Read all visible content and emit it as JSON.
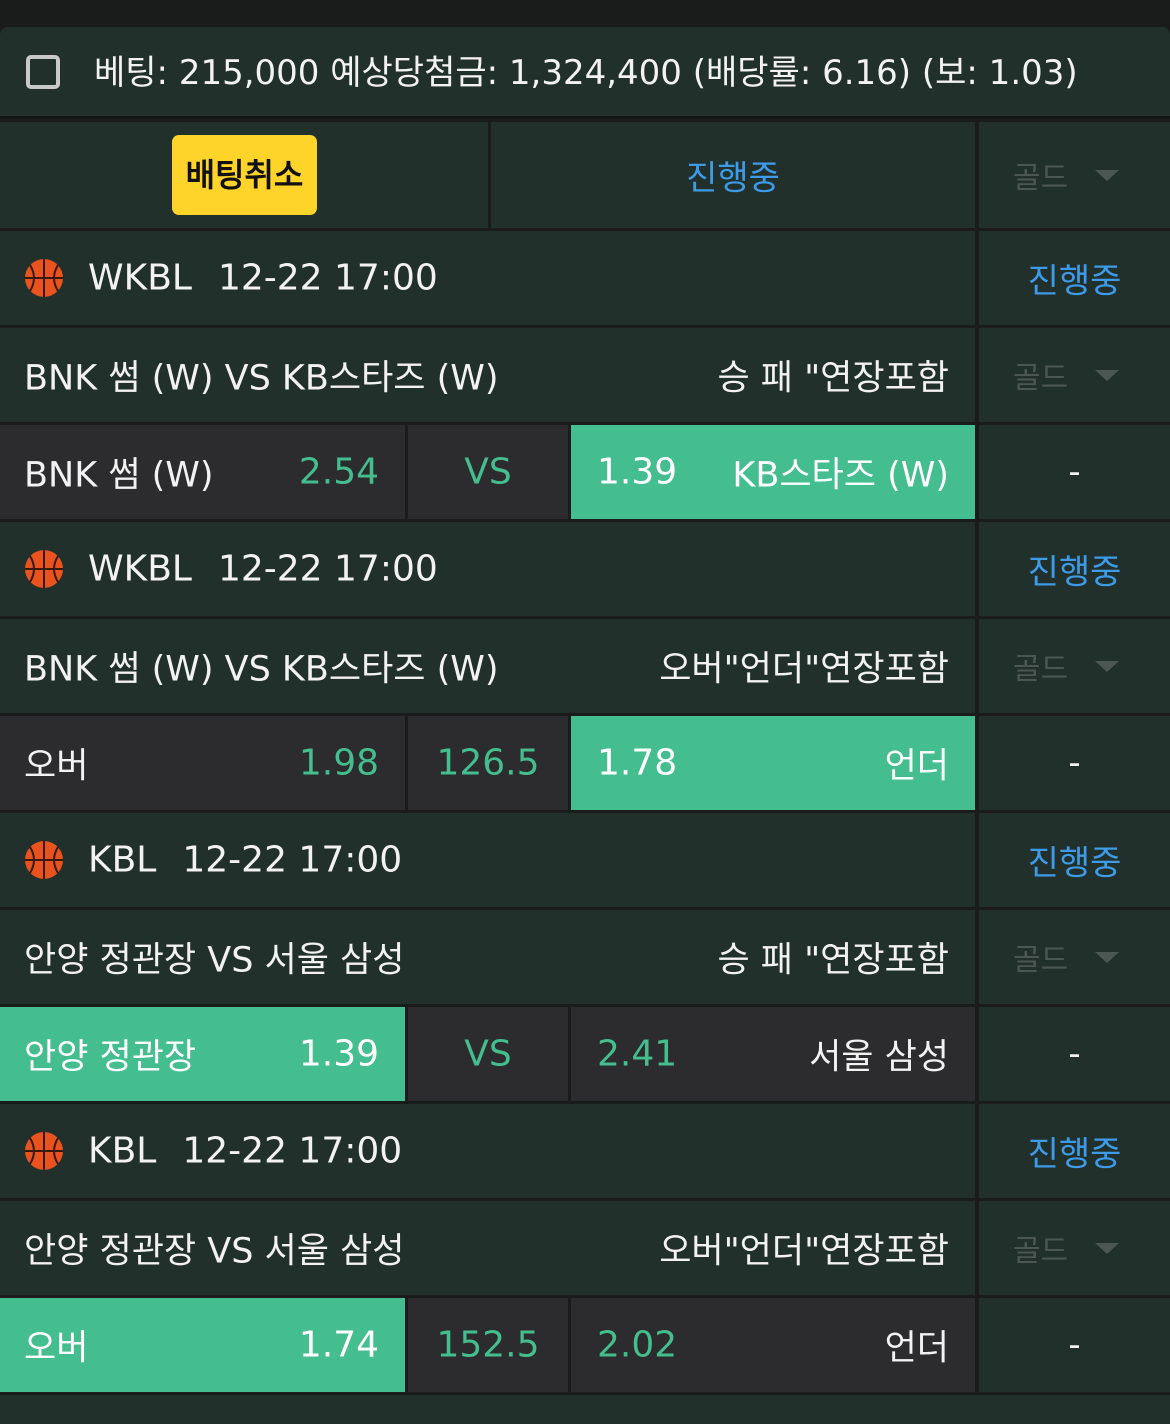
{
  "summary": {
    "text": "베팅: 215,000 예상당첨금: 1,324,400 (배당률: 6.16) (보: 1.03)"
  },
  "controls": {
    "cancel_label": "배팅취소",
    "status_label": "진행중",
    "gold_label": "골드"
  },
  "icons": {
    "league": "basketball-icon",
    "dropdown": "caret-down-icon",
    "checkbox": "checkbox-icon"
  },
  "colors": {
    "panel": "#21302b",
    "odds_bg": "#2c2c2e",
    "selected": "#44bd8f",
    "status": "#3d9be9",
    "cancel_button": "#ffd42a"
  },
  "bets": [
    {
      "league": "WKBL",
      "datetime": "12-22 17:00",
      "status": "진행중",
      "match": "BNK 썸 (W)  VS KB스타즈 (W)",
      "market": "승 패 \"연장포함",
      "gold": "골드",
      "home_name": "BNK 썸 (W)",
      "home_odds": "2.54",
      "middle": "VS",
      "away_odds": "1.39",
      "away_name": "KB스타즈 (W)",
      "selected": "away",
      "result": "-"
    },
    {
      "league": "WKBL",
      "datetime": "12-22 17:00",
      "status": "진행중",
      "match": "BNK 썸 (W)  VS KB스타즈 (W)",
      "market": "오버\"언더\"연장포함",
      "gold": "골드",
      "home_name": "오버",
      "home_odds": "1.98",
      "middle": "126.5",
      "away_odds": "1.78",
      "away_name": "언더",
      "selected": "away",
      "result": "-"
    },
    {
      "league": "KBL",
      "datetime": "12-22 17:00",
      "status": "진행중",
      "match": "안양 정관장 VS 서울 삼성",
      "market": "승 패 \"연장포함",
      "gold": "골드",
      "home_name": "안양 정관장",
      "home_odds": "1.39",
      "middle": "VS",
      "away_odds": "2.41",
      "away_name": "서울 삼성",
      "selected": "home",
      "result": "-"
    },
    {
      "league": "KBL",
      "datetime": "12-22 17:00",
      "status": "진행중",
      "match": "안양 정관장 VS 서울 삼성",
      "market": "오버\"언더\"연장포함",
      "gold": "골드",
      "home_name": "오버",
      "home_odds": "1.74",
      "middle": "152.5",
      "away_odds": "2.02",
      "away_name": "언더",
      "selected": "home",
      "result": "-"
    }
  ]
}
